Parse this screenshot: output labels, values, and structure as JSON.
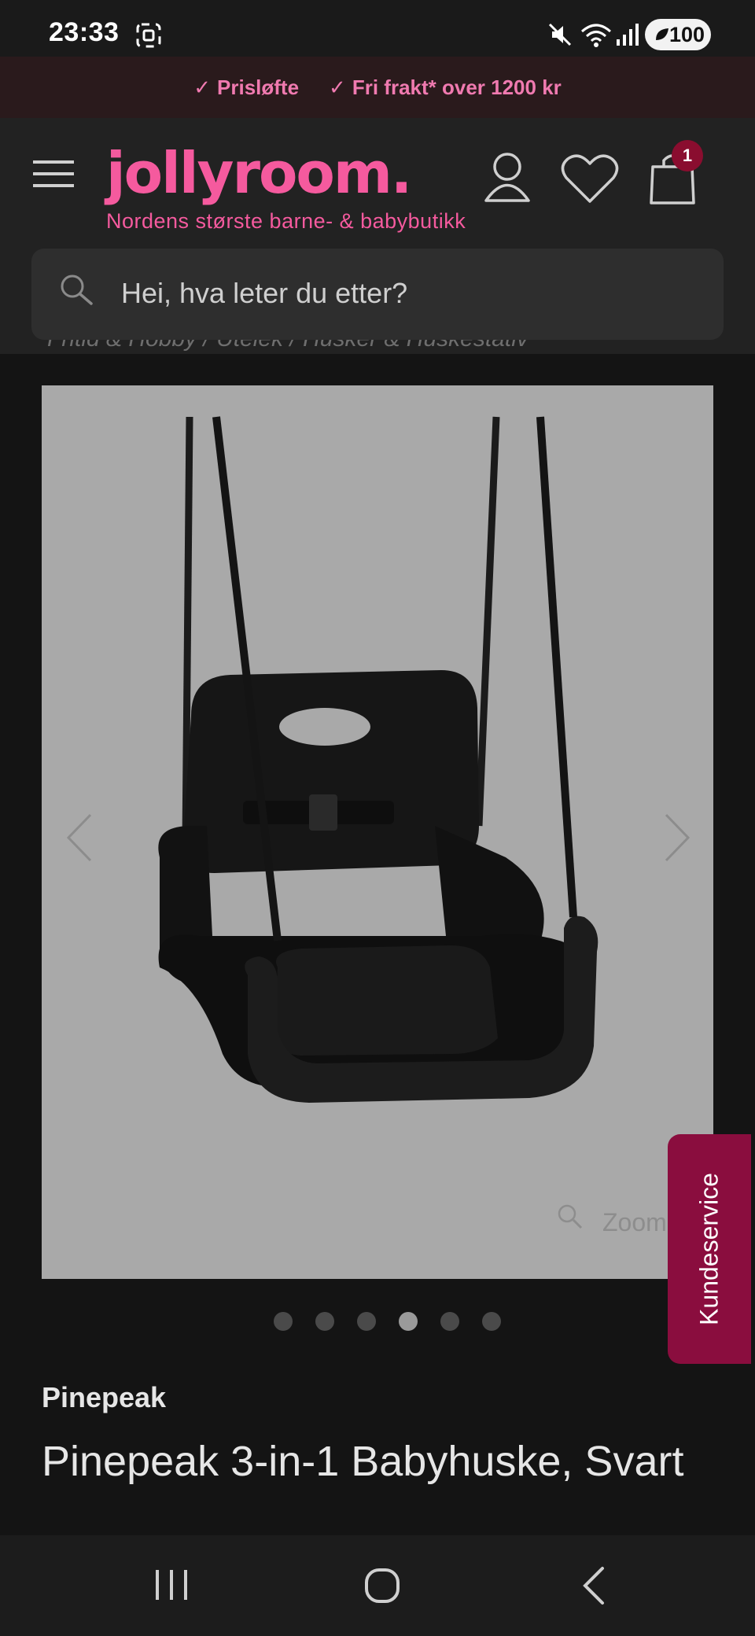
{
  "status_bar": {
    "time": "23:33",
    "battery": "100"
  },
  "promo": {
    "item1": "Prisløfte",
    "item2": "Fri frakt* over 1200 kr"
  },
  "header": {
    "logo": "jollyroom.",
    "tagline": "Nordens største barne- & babybutikk",
    "cart_count": "1"
  },
  "search": {
    "placeholder": "Hei, hva leter du etter?"
  },
  "breadcrumb": "Fritid & Hobby / Utelek / Husker & Huskestativ",
  "gallery": {
    "zoom_label": "Zoom",
    "dot_count": 6,
    "active_dot": 4
  },
  "customer_service": "Kundeservice",
  "product": {
    "brand": "Pinepeak",
    "title": "Pinepeak 3-in-1 Babyhuske, Svart"
  },
  "colors": {
    "accent": "#f55a9e",
    "badge": "#8a0d2f",
    "customer_service_bg": "#8a0d3e"
  }
}
